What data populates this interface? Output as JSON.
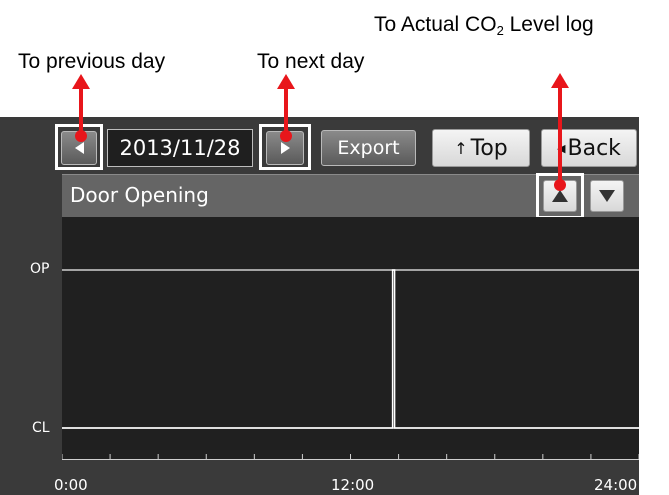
{
  "callouts": {
    "co2_log": "To Actual CO",
    "co2_sub": "2",
    "co2_suffix": " Level log",
    "previous_day": "To previous day",
    "next_day": "To next day"
  },
  "toolbar": {
    "date": "2013/11/28",
    "export_label": "Export",
    "top_label": "Top",
    "back_label": "Back"
  },
  "panel": {
    "title": "Door Opening"
  },
  "colors": {
    "callout_red": "#e8161b",
    "screen_bg": "#3a3a3a",
    "plot_bg": "#202020"
  },
  "chart_data": {
    "type": "line",
    "title": "Door Opening",
    "x_ticks": [
      "0:00",
      "12:00",
      "24:00"
    ],
    "y_ticks": [
      "OP",
      "CL"
    ],
    "series": [
      {
        "x": [
          "0:00",
          "13:45",
          "13:45",
          "13:50",
          "13:50",
          "24:00"
        ],
        "values": [
          "CL",
          "CL",
          "OP",
          "OP",
          "CL",
          "CL"
        ]
      }
    ]
  }
}
